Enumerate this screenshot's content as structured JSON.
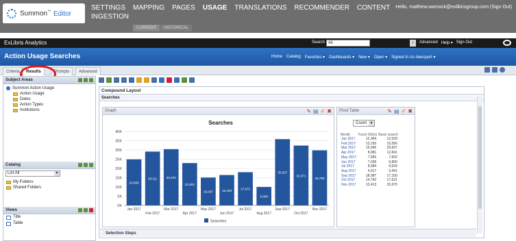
{
  "summon": {
    "brand": "Summon",
    "brand_mark": "™",
    "editor": "Editor",
    "nav": [
      "SETTINGS",
      "MAPPING",
      "PAGES",
      "USAGE",
      "TRANSLATIONS",
      "RECOMMENDER",
      "CONTENT"
    ],
    "nav_active": "USAGE",
    "nav_second_line": "INGESTION",
    "greeting": "Hello, matthew.warnock@exlibrisgroup.com (Sign Out)",
    "subtabs": [
      "CURRENT",
      "HISTORICAL"
    ]
  },
  "exlibris": {
    "logo": "ExLibris Analytics",
    "search_label": "Search",
    "search_value": "All",
    "links": [
      "Advanced",
      "Help ▾",
      "Sign Out"
    ]
  },
  "header": {
    "title": "Action Usage Searches",
    "links": [
      "Home",
      "Catalog",
      "Favorites ▾",
      "Dashboards ▾",
      "New ▾",
      "Open ▾",
      "Signed In As  dwesport ▾"
    ]
  },
  "tabs": [
    "Criteria",
    "Results",
    "Prompts",
    "Advanced"
  ],
  "tabs_active": "Results",
  "subject_areas": {
    "title": "Subject Areas",
    "root": "Summon Action Usage",
    "children": [
      "Action Usage",
      "Dates",
      "Action Types",
      "Institutions"
    ]
  },
  "catalog": {
    "title": "Catalog",
    "select_value": "List  All",
    "folders": [
      "My Folders",
      "Shared Folders"
    ]
  },
  "views": {
    "title": "Views",
    "items": [
      "Title",
      "Table"
    ]
  },
  "main": {
    "compound_layout": "Compound Layout",
    "searches_label": "Searches",
    "graph_label": "Graph",
    "pivot_label": "Pivot Table",
    "pivot_measure": "Count",
    "pivot_headers": [
      "Month",
      "Facet Sht(s)",
      "Basic search"
    ],
    "pivot_rows": [
      [
        "Jan 2017",
        "12,364",
        "12,529"
      ],
      [
        "Feb 2017",
        "13,155",
        "15,556"
      ],
      [
        "Mar 2017",
        "15,946",
        "29,507"
      ],
      [
        "Apr 2017",
        "8,081",
        "12,841"
      ],
      [
        "May 2017",
        "7,555",
        "7,602"
      ],
      [
        "Jun 2017",
        "7,028",
        "6,800"
      ],
      [
        "Jul 2017",
        "8,084",
        "9,918"
      ],
      [
        "Aug 2017",
        "4,917",
        "5,491"
      ],
      [
        "Sep 2017",
        "18,087",
        "17,150"
      ],
      [
        "Oct 2017",
        "14,750",
        "17,621"
      ],
      [
        "Nov 2017",
        "13,413",
        "15,670"
      ]
    ],
    "selection_steps": "Selection Steps"
  },
  "chart_data": {
    "type": "bar",
    "title": "Searches",
    "categories": [
      "Jan 2017",
      "Feb 2017",
      "Mar 2017",
      "Apr 2017",
      "May 2017",
      "Jun 2017",
      "Jul 2017",
      "Aug 2017",
      "Sep 2017",
      "Oct 2017",
      "Nov 2017"
    ],
    "values": [
      24893,
      29111,
      30423,
      22903,
      15057,
      16428,
      17972,
      9968,
      35837,
      32371,
      29785
    ],
    "value_labels": [
      "24,893",
      "29,111",
      "30,423",
      "22,903",
      "15,057",
      "16,428",
      "17,972",
      "9,968",
      "35,837",
      "32,371",
      "29,785"
    ],
    "yticks": [
      "0K",
      "5K",
      "10K",
      "15K",
      "20K",
      "25K",
      "30K",
      "35K",
      "40K"
    ],
    "ylim": [
      0,
      40000
    ],
    "legend": [
      "Searches"
    ],
    "legend_position": "bottom",
    "bar_color": "#24569d"
  }
}
